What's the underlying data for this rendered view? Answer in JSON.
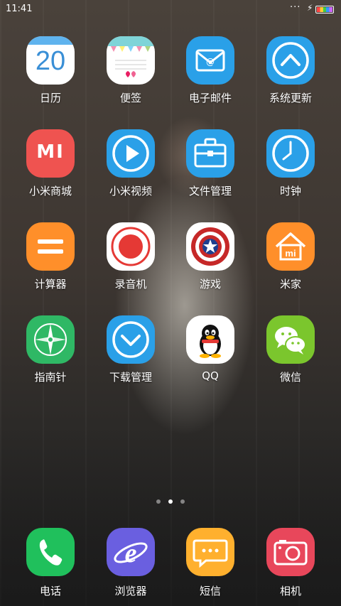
{
  "status_bar": {
    "time": "11:41",
    "signal_dots": "···"
  },
  "apps": [
    {
      "label": "日历",
      "icon": "calendar-icon",
      "text": "20"
    },
    {
      "label": "便签",
      "icon": "notes-icon"
    },
    {
      "label": "电子邮件",
      "icon": "email-icon"
    },
    {
      "label": "系统更新",
      "icon": "system-update-icon"
    },
    {
      "label": "小米商城",
      "icon": "mi-store-icon",
      "text": "MI"
    },
    {
      "label": "小米视频",
      "icon": "mi-video-icon"
    },
    {
      "label": "文件管理",
      "icon": "file-manager-icon"
    },
    {
      "label": "时钟",
      "icon": "clock-icon"
    },
    {
      "label": "计算器",
      "icon": "calculator-icon"
    },
    {
      "label": "录音机",
      "icon": "recorder-icon"
    },
    {
      "label": "游戏",
      "icon": "games-icon"
    },
    {
      "label": "米家",
      "icon": "mijia-icon"
    },
    {
      "label": "指南针",
      "icon": "compass-icon"
    },
    {
      "label": "下载管理",
      "icon": "download-manager-icon"
    },
    {
      "label": "QQ",
      "icon": "qq-icon"
    },
    {
      "label": "微信",
      "icon": "wechat-icon"
    }
  ],
  "dock": [
    {
      "label": "电话",
      "icon": "phone-icon"
    },
    {
      "label": "浏览器",
      "icon": "browser-icon"
    },
    {
      "label": "短信",
      "icon": "messages-icon"
    },
    {
      "label": "相机",
      "icon": "camera-icon"
    }
  ],
  "pager": {
    "total": 3,
    "active": 2
  },
  "colors": {
    "calendar": "#ffffff",
    "mi_store": "#ef5350",
    "blue": "#2aa0e8",
    "orange": "#ff8f2a",
    "compass": "#2fb865",
    "phone": "#20c05c",
    "browser": "#6a5fe0",
    "messages": "#ffb02e",
    "camera": "#e8475b",
    "wechat": "#7bc62d"
  }
}
